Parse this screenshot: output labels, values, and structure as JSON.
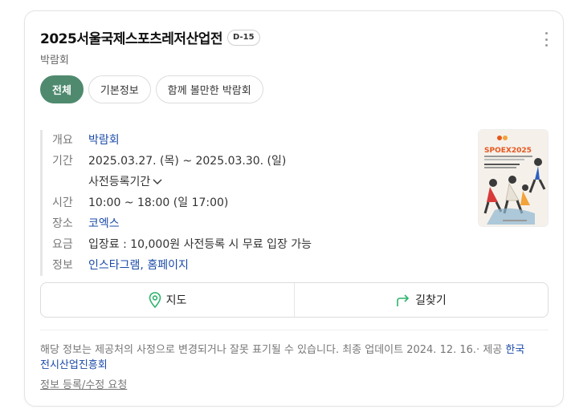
{
  "header": {
    "title": "2025서울국제스포츠레저산업전",
    "dday": "D-15",
    "subtitle": "박람회"
  },
  "tabs": [
    {
      "label": "전체",
      "active": true
    },
    {
      "label": "기본정보",
      "active": false
    },
    {
      "label": "함께 볼만한 박람회",
      "active": false
    }
  ],
  "info": {
    "overview_label": "개요",
    "overview_value": "박람회",
    "period_label": "기간",
    "period_value": "2025.03.27. (목) ~  2025.03.30. (일)",
    "preregister_label": "사전등록기간",
    "time_label": "시간",
    "time_value": "10:00 ~ 18:00 (일 17:00)",
    "venue_label": "장소",
    "venue_value": "코엑스",
    "fee_label": "요금",
    "fee_value": "입장료 : 10,000원 사전등록 시 무료 입장 가능",
    "links_label": "정보",
    "link_instagram": "인스타그램",
    "link_sep": ", ",
    "link_homepage": "홈페이지"
  },
  "poster": {
    "brand_text": "SPOEX2025",
    "colors": {
      "accent": "#e8561d",
      "bg": "#f5f1ea"
    }
  },
  "actions": {
    "map_label": "지도",
    "directions_label": "길찾기",
    "map_icon": "map-pin-icon",
    "directions_icon": "route-arrow-icon",
    "accent": "#2db36b"
  },
  "footer": {
    "notice_text": "해당 정보는 제공처의 사정으로 변경되거나 잘못 표기될 수 있습니다. 최종 업데이트 2024. 12. 16.· 제공 ",
    "provider": "한국전시산업진흥회",
    "report_label": "정보 등록/수정 요청"
  }
}
